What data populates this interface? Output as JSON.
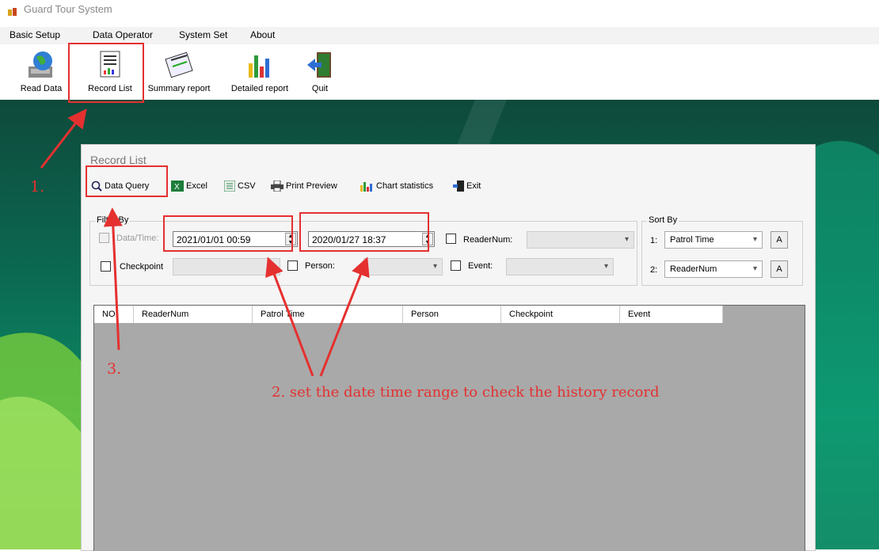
{
  "app": {
    "title": "Guard Tour System"
  },
  "menu": [
    {
      "label": "Basic Setup"
    },
    {
      "label": "Data Operator"
    },
    {
      "label": "System Set"
    },
    {
      "label": "About"
    }
  ],
  "toolbar": [
    {
      "label": "Read Data",
      "icon": "globe-computer-icon"
    },
    {
      "label": "Record List",
      "icon": "document-list-icon"
    },
    {
      "label": "Summary report",
      "icon": "summary-report-icon"
    },
    {
      "label": "Detailed report",
      "icon": "bar-chart-icon"
    },
    {
      "label": "Quit",
      "icon": "exit-door-icon"
    }
  ],
  "window": {
    "title": "Record List",
    "toolbar": [
      {
        "label": "Data Query",
        "icon": "magnifier-icon"
      },
      {
        "label": "Excel",
        "icon": "excel-icon"
      },
      {
        "label": "CSV",
        "icon": "csv-icon"
      },
      {
        "label": "Print Preview",
        "icon": "printer-icon"
      },
      {
        "label": "Chart statistics",
        "icon": "chart-icon"
      },
      {
        "label": "Exit",
        "icon": "exit-icon"
      }
    ],
    "filter": {
      "legend": "Filter By",
      "datetime_label": "Data/Time:",
      "datetime_checked": true,
      "start": "2021/01/01 00:59",
      "end": "2020/01/27 18:37",
      "readernum_label": "ReaderNum:",
      "checkpoint_label": "Checkpoint",
      "person_label": "Person:",
      "event_label": "Event:"
    },
    "sort": {
      "legend": "Sort By",
      "rows": [
        {
          "idx": "1:",
          "value": "Patrol Time",
          "btn": "A"
        },
        {
          "idx": "2:",
          "value": "ReaderNum",
          "btn": "A"
        }
      ]
    },
    "columns": [
      "NO.",
      "ReaderNum",
      "Patrol Time",
      "Person",
      "Checkpoint",
      "Event"
    ]
  },
  "annotations": {
    "step1": "1.",
    "step2": "2. set the date time range to check the history record",
    "step3": "3.",
    "color": "#e53030"
  }
}
